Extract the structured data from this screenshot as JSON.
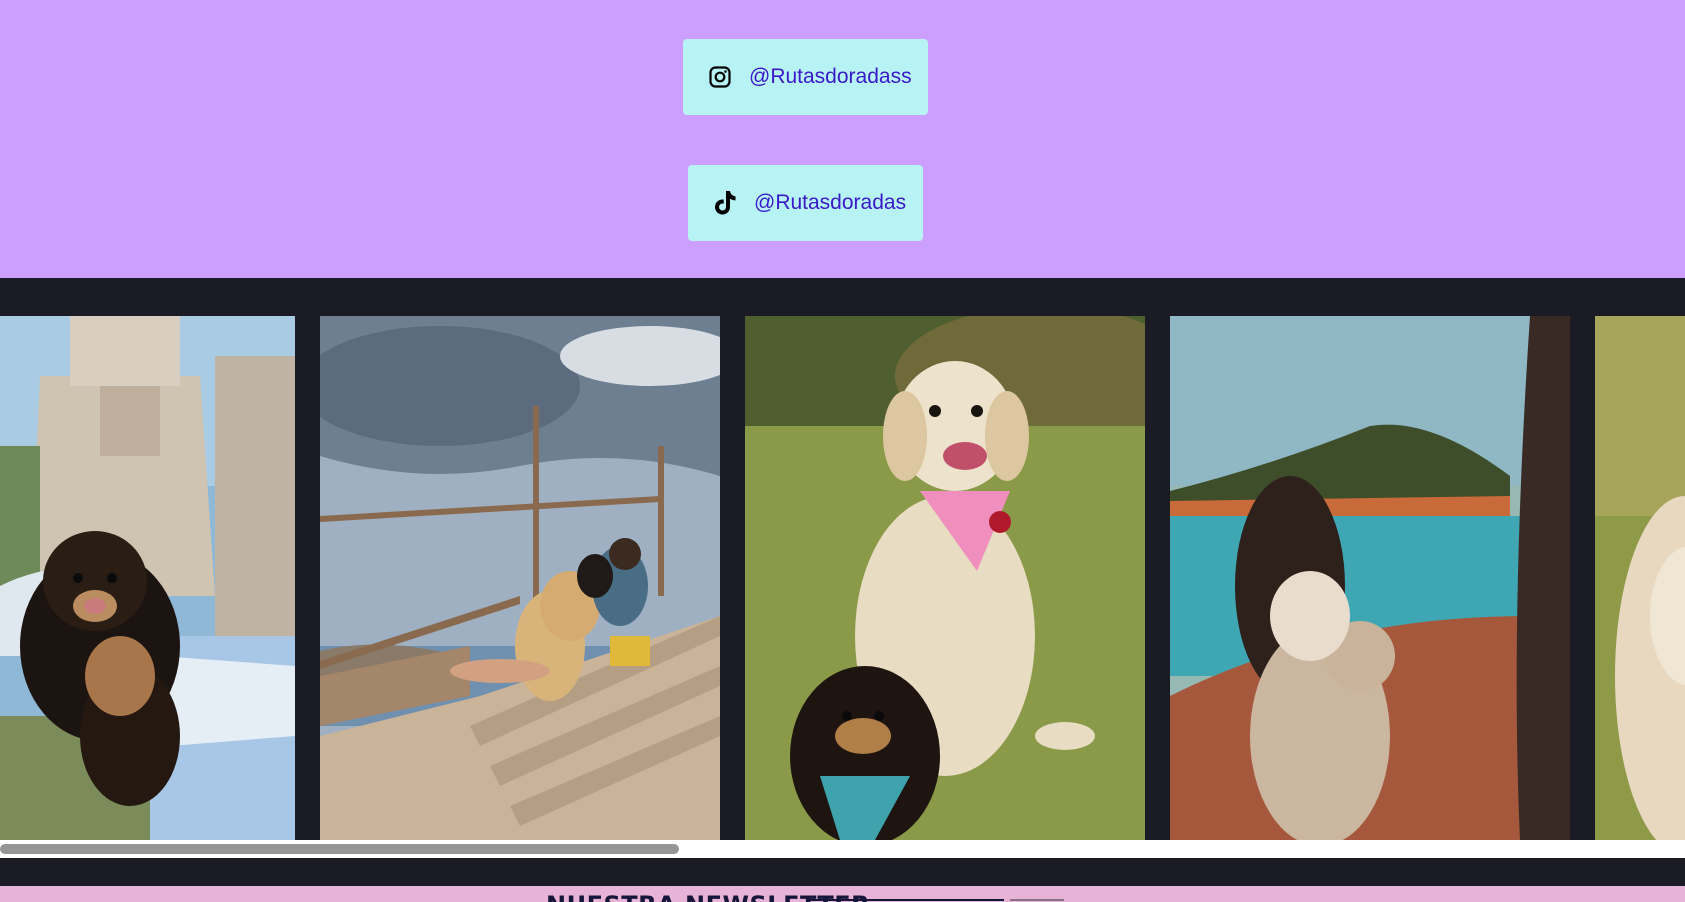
{
  "social": {
    "instagram": {
      "handle": "@Rutasdoradass",
      "icon": "instagram-icon"
    },
    "tiktok": {
      "handle": "@Rutasdoradas",
      "icon": "tiktok-icon"
    },
    "background_color": "#cc9ffe",
    "button_color": "#b7f2f4",
    "link_color": "#3a19c9"
  },
  "gallery": {
    "background_color": "#1b1b26",
    "photos": [
      {
        "subject": "pomeranian-puppy-at-monument"
      },
      {
        "subject": "couple-with-golden-retriever-on-stairs"
      },
      {
        "subject": "golden-retriever-and-pomeranian-on-grass"
      },
      {
        "subject": "woman-with-dog-at-coastal-cliff"
      },
      {
        "subject": "golden-retriever-close-up"
      }
    ],
    "scrollbar": {
      "position": 0.0
    }
  },
  "newsletter": {
    "title": "NUESTRA NEWSLETTER",
    "background_color": "#e7b4d8"
  }
}
